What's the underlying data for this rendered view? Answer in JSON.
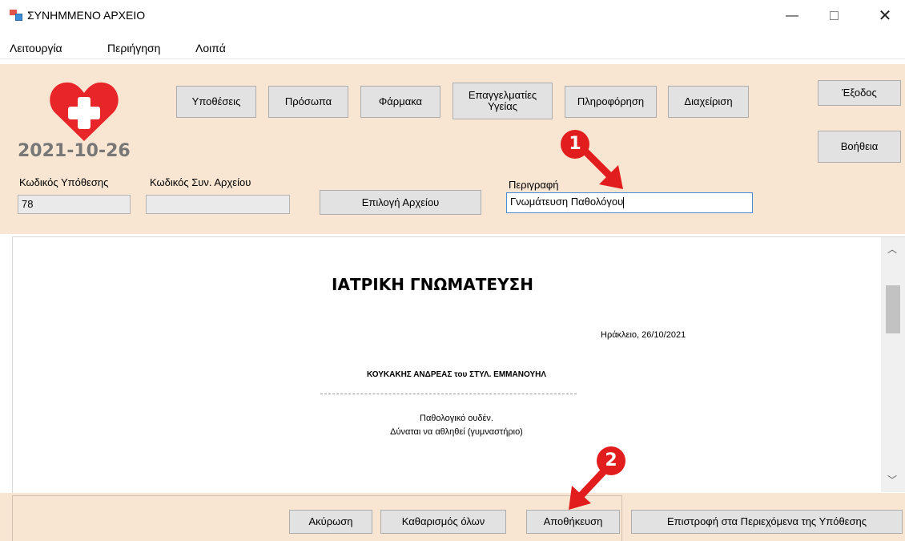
{
  "window": {
    "title": "ΣΥΝΗΜΜΕΝΟ ΑΡΧΕΙΟ",
    "minimize": "—",
    "close": "✕"
  },
  "menu": [
    "Λειτουργία",
    "Περιήγηση",
    "Λοιπά"
  ],
  "header": {
    "date": "2021-10-26",
    "nav": [
      "Υποθέσεις",
      "Πρόσωπα",
      "Φάρμακα",
      "Επαγγελματίες Υγείας",
      "Πληροφόρηση",
      "Διαχείριση"
    ],
    "exit": "Έξοδος",
    "help": "Βοήθεια"
  },
  "form": {
    "case_code_label": "Κωδικός Υπόθεσης",
    "case_code_value": "78",
    "file_code_label": "Κωδικός Συν. Αρχείου",
    "file_code_value": "",
    "select_file": "Επιλογή Αρχείου",
    "description_label": "Περιγραφή",
    "description_value": "Γνωμάτευση Παθολόγου"
  },
  "document": {
    "title": "ΙΑΤΡΙΚΗ ΓΝΩΜΑΤΕΥΣΗ",
    "place_date": "Ηράκλειο,  26/10/2021",
    "patient": "ΚΟΥΚΑΚΗΣ ΑΝΔΡΕΑΣ του ΣΤΥΛ. ΕΜΜΑΝΟΥΗΛ",
    "line1": "Παθολογικό ουδέν.",
    "line2": "Δύναται να αθληθεί (γυμναστήριο)"
  },
  "footer": {
    "cancel": "Ακύρωση",
    "clear_all": "Καθαρισμός όλων",
    "save": "Αποθήκευση",
    "back": "Επιστροφή στα Περιεχόμενα της Υπόθεσης"
  },
  "annotations": {
    "step1": "1",
    "step2": "2",
    "color": "#e21d1d"
  },
  "colors": {
    "panel": "#f8e6d2",
    "heart": "#e8262a"
  }
}
